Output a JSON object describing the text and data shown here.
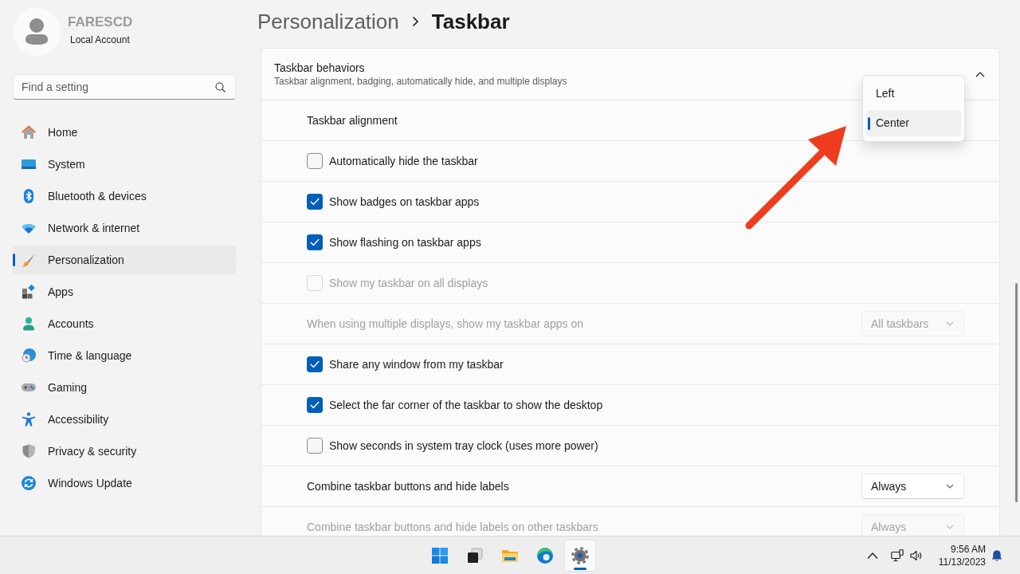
{
  "account": {
    "name": "FARESCD",
    "type": "Local Account"
  },
  "search": {
    "placeholder": "Find a setting"
  },
  "sidebar": {
    "items": [
      {
        "label": "Home",
        "selected": false
      },
      {
        "label": "System",
        "selected": false
      },
      {
        "label": "Bluetooth & devices",
        "selected": false
      },
      {
        "label": "Network & internet",
        "selected": false
      },
      {
        "label": "Personalization",
        "selected": true
      },
      {
        "label": "Apps",
        "selected": false
      },
      {
        "label": "Accounts",
        "selected": false
      },
      {
        "label": "Time & language",
        "selected": false
      },
      {
        "label": "Gaming",
        "selected": false
      },
      {
        "label": "Accessibility",
        "selected": false
      },
      {
        "label": "Privacy & security",
        "selected": false
      },
      {
        "label": "Windows Update",
        "selected": false
      }
    ]
  },
  "breadcrumb": [
    {
      "label": "Personalization",
      "current": false
    },
    {
      "label": "Taskbar",
      "current": true
    }
  ],
  "section": {
    "title": "Taskbar behaviors",
    "subtitle": "Taskbar alignment, badging, automatically hide, and multiple displays",
    "expanded": true,
    "rows": [
      {
        "kind": "dropdown",
        "label": "Taskbar alignment",
        "disabled": false,
        "open": true,
        "options": [
          {
            "label": "Left",
            "selected": false
          },
          {
            "label": "Center",
            "selected": true
          }
        ]
      },
      {
        "kind": "checkbox",
        "label": "Automatically hide the taskbar",
        "checked": false,
        "disabled": false
      },
      {
        "kind": "checkbox",
        "label": "Show badges on taskbar apps",
        "checked": true,
        "disabled": false
      },
      {
        "kind": "checkbox",
        "label": "Show flashing on taskbar apps",
        "checked": true,
        "disabled": false
      },
      {
        "kind": "checkbox",
        "label": "Show my taskbar on all displays",
        "checked": false,
        "disabled": true
      },
      {
        "kind": "dropdown",
        "label": "When using multiple displays, show my taskbar apps on",
        "disabled": true,
        "open": false,
        "value": "All taskbars"
      },
      {
        "kind": "checkbox",
        "label": "Share any window from my taskbar",
        "checked": true,
        "disabled": false
      },
      {
        "kind": "checkbox",
        "label": "Select the far corner of the taskbar to show the desktop",
        "checked": true,
        "disabled": false
      },
      {
        "kind": "checkbox",
        "label": "Show seconds in system tray clock (uses more power)",
        "checked": false,
        "disabled": false
      },
      {
        "kind": "dropdown",
        "label": "Combine taskbar buttons and hide labels",
        "disabled": false,
        "open": false,
        "value": "Always"
      },
      {
        "kind": "dropdown",
        "label": "Combine taskbar buttons and hide labels on other taskbars",
        "disabled": true,
        "open": false,
        "value": "Always"
      }
    ]
  },
  "taskbar": {
    "apps": [
      {
        "active": false
      },
      {
        "active": false
      },
      {
        "active": false
      },
      {
        "active": false
      },
      {
        "active": true
      }
    ],
    "clock": {
      "time": "9:56 AM",
      "date": "11/13/2023"
    }
  }
}
